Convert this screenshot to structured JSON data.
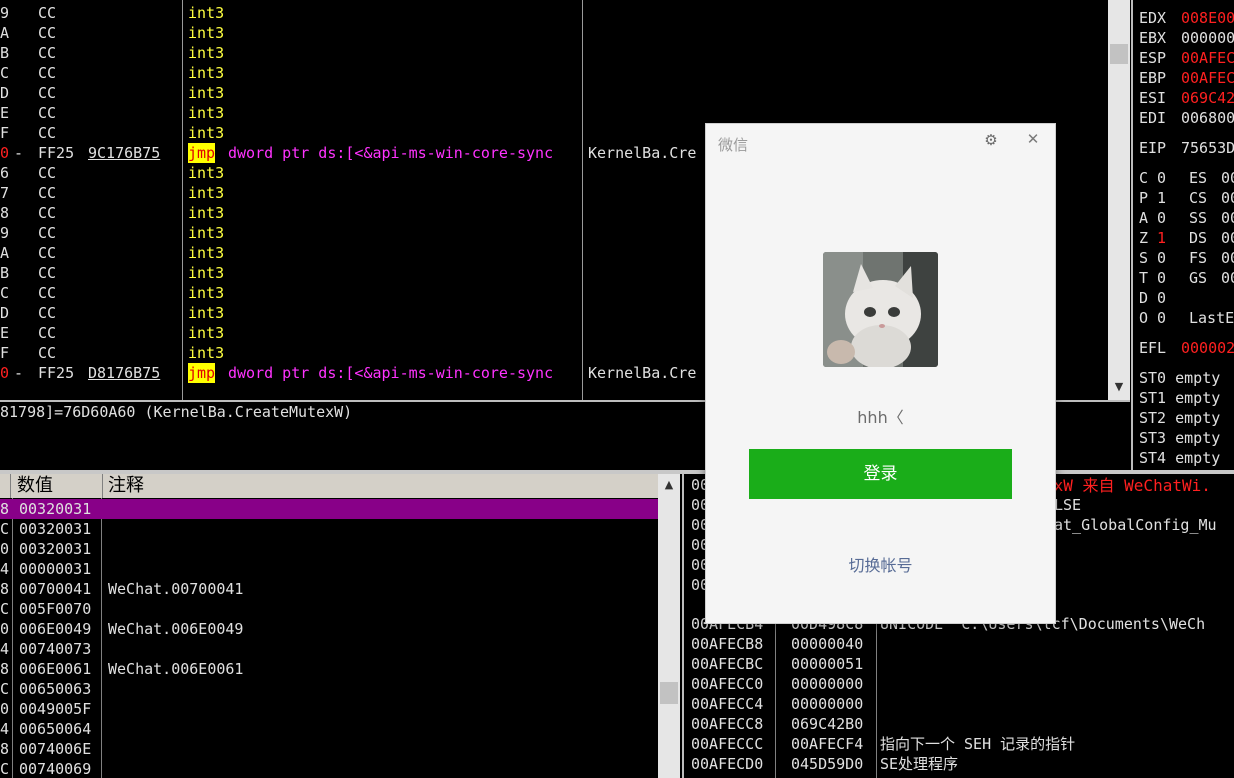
{
  "disasm": {
    "rows": [
      {
        "a": "9",
        "b": "CC",
        "c": "",
        "i": "int3",
        "k": ""
      },
      {
        "a": "A",
        "b": "CC",
        "c": "",
        "i": "int3",
        "k": ""
      },
      {
        "a": "B",
        "b": "CC",
        "c": "",
        "i": "int3",
        "k": ""
      },
      {
        "a": "C",
        "b": "CC",
        "c": "",
        "i": "int3",
        "k": ""
      },
      {
        "a": "D",
        "b": "CC",
        "c": "",
        "i": "int3",
        "k": ""
      },
      {
        "a": "E",
        "b": "CC",
        "c": "",
        "i": "int3",
        "k": ""
      },
      {
        "a": "F",
        "b": "CC",
        "c": "",
        "i": "int3",
        "k": ""
      },
      {
        "a": "0",
        "m": "-",
        "b": "FF25",
        "c": "9C176B75",
        "jmp": "jmp",
        "op": "dword ptr ds:[<&api-ms-win-core-sync",
        "k": "KernelBa.Cre"
      },
      {
        "a": "6",
        "b": "CC",
        "c": "",
        "i": "int3",
        "k": ""
      },
      {
        "a": "7",
        "b": "CC",
        "c": "",
        "i": "int3",
        "k": ""
      },
      {
        "a": "8",
        "b": "CC",
        "c": "",
        "i": "int3",
        "k": ""
      },
      {
        "a": "9",
        "b": "CC",
        "c": "",
        "i": "int3",
        "k": ""
      },
      {
        "a": "A",
        "b": "CC",
        "c": "",
        "i": "int3",
        "k": ""
      },
      {
        "a": "B",
        "b": "CC",
        "c": "",
        "i": "int3",
        "k": ""
      },
      {
        "a": "C",
        "b": "CC",
        "c": "",
        "i": "int3",
        "k": ""
      },
      {
        "a": "D",
        "b": "CC",
        "c": "",
        "i": "int3",
        "k": ""
      },
      {
        "a": "E",
        "b": "CC",
        "c": "",
        "i": "int3",
        "k": ""
      },
      {
        "a": "F",
        "b": "CC",
        "c": "",
        "i": "int3",
        "k": ""
      },
      {
        "a": "0",
        "m": "-",
        "b": "FF25",
        "c": "D8176B75",
        "jmp": "jmp",
        "op": "dword ptr ds:[<&api-ms-win-core-sync",
        "k": "KernelBa.Cre"
      }
    ],
    "info_line": "81798]=76D60A60 (KernelBa.CreateMutexW)"
  },
  "registers": {
    "top_row": {
      "n": "EDX",
      "v": "008E00"
    },
    "rows": [
      {
        "n": "EBX",
        "v": "000000",
        "red": false
      },
      {
        "n": "ESP",
        "v": "00AFEC",
        "red": true
      },
      {
        "n": "EBP",
        "v": "00AFEC",
        "red": true
      },
      {
        "n": "ESI",
        "v": "069C42",
        "red": true
      },
      {
        "n": "EDI",
        "v": "006800",
        "red": false
      }
    ],
    "partial_top": "EDX",
    "eip": {
      "n": "EIP",
      "v": "75653D"
    },
    "flags": [
      {
        "f": "C",
        "v": "0",
        "s": "ES",
        "sv": "00"
      },
      {
        "f": "P",
        "v": "1",
        "s": "CS",
        "sv": "00"
      },
      {
        "f": "A",
        "v": "0",
        "s": "SS",
        "sv": "00"
      },
      {
        "f": "Z",
        "v": "1",
        "s": "DS",
        "sv": "00",
        "red": true
      },
      {
        "f": "S",
        "v": "0",
        "s": "FS",
        "sv": "00"
      },
      {
        "f": "T",
        "v": "0",
        "s": "GS",
        "sv": "00"
      },
      {
        "f": "D",
        "v": "0",
        "s": "",
        "sv": ""
      },
      {
        "f": "O",
        "v": "0",
        "s": "LastE",
        "sv": ""
      }
    ],
    "efl": {
      "n": "EFL",
      "v": "000002"
    },
    "fpu": [
      "ST0 empty",
      "ST1 empty",
      "ST2 empty",
      "ST3 empty",
      "ST4 empty"
    ]
  },
  "dump": {
    "header": {
      "col1": "数值",
      "col2": "注释"
    },
    "rows": [
      {
        "a": "8",
        "v": "00320031",
        "c": "",
        "hl": true
      },
      {
        "a": "C",
        "v": "00320031",
        "c": ""
      },
      {
        "a": "0",
        "v": "00320031",
        "c": ""
      },
      {
        "a": "4",
        "v": "00000031",
        "c": ""
      },
      {
        "a": "8",
        "v": "00700041",
        "c": "WeChat.00700041"
      },
      {
        "a": "C",
        "v": "005F0070",
        "c": ""
      },
      {
        "a": "0",
        "v": "006E0049",
        "c": "WeChat.006E0049"
      },
      {
        "a": "4",
        "v": "00740073",
        "c": ""
      },
      {
        "a": "8",
        "v": "006E0061",
        "c": "WeChat.006E0061"
      },
      {
        "a": "C",
        "v": "00650063",
        "c": ""
      },
      {
        "a": "0",
        "v": "0049005F",
        "c": ""
      },
      {
        "a": "4",
        "v": "00650064",
        "c": ""
      },
      {
        "a": "8",
        "v": "0074006E",
        "c": ""
      },
      {
        "a": "C",
        "v": "00740069",
        "c": ""
      }
    ]
  },
  "stack": {
    "header_tail": "exW 来自 WeChatWi.",
    "partial_rows": [
      {
        "t": "00",
        "r": ""
      },
      {
        "t": "00",
        "r": "LSE"
      },
      {
        "t": "00",
        "r": "at_GlobalConfig_Mu"
      },
      {
        "t": "00",
        "r": ""
      },
      {
        "t": "00",
        "r": ""
      },
      {
        "t": "00",
        "r": ""
      }
    ],
    "rows": [
      {
        "addr": "00AFECB4",
        "val": "00D498C8",
        "cmt": "UNICODE \"C:\\Users\\lcf\\Documents\\WeCh"
      },
      {
        "addr": "00AFECB8",
        "val": "00000040",
        "cmt": ""
      },
      {
        "addr": "00AFECBC",
        "val": "00000051",
        "cmt": ""
      },
      {
        "addr": "00AFECC0",
        "val": "00000000",
        "cmt": ""
      },
      {
        "addr": "00AFECC4",
        "val": "00000000",
        "cmt": ""
      },
      {
        "addr": "00AFECC8",
        "val": "069C42B0",
        "cmt": ""
      },
      {
        "addr": "00AFECCC",
        "val": "00AFECF4",
        "cmt": "指向下一个 SEH 记录的指针"
      },
      {
        "addr": "00AFECD0",
        "val": "045D59D0",
        "cmt": "SE处理程序"
      }
    ]
  },
  "wechat": {
    "title": "微信",
    "username": "hhh〈",
    "login_label": "登录",
    "switch_label": "切换帐号",
    "accent": "#1aad19"
  }
}
